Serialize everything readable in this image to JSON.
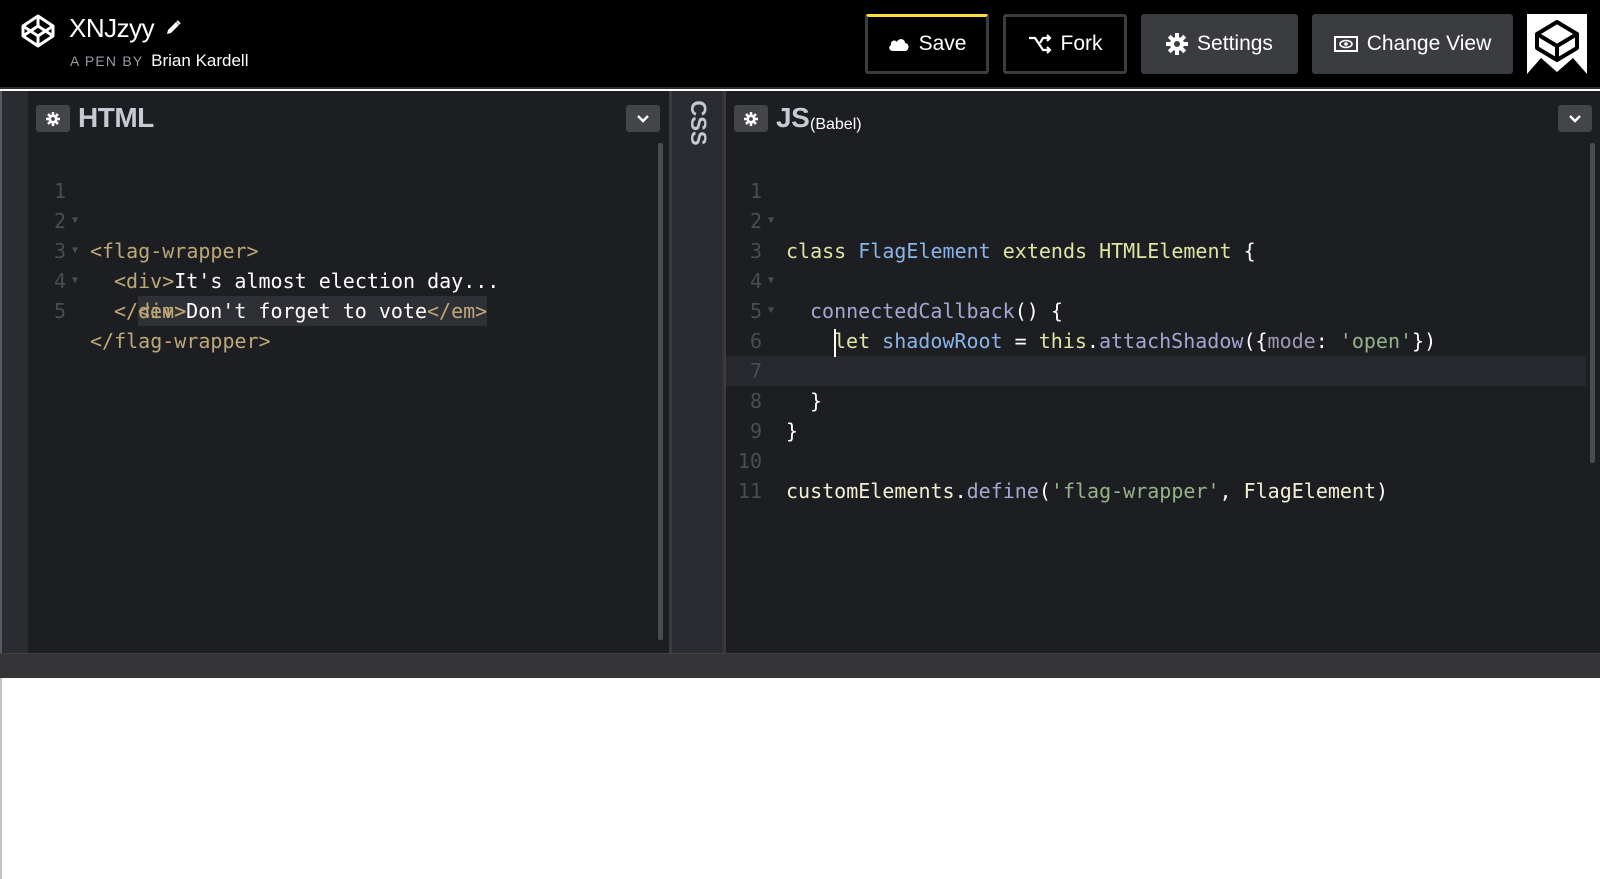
{
  "header": {
    "pen_title": "XNJzyy",
    "byline_prefix": "A PEN BY",
    "author": "Brian Kardell",
    "buttons": {
      "save": "Save",
      "fork": "Fork",
      "settings": "Settings",
      "change_view": "Change View"
    },
    "save_accent_color": "#ffdd40"
  },
  "html_editor": {
    "title": "HTML",
    "lines": [
      {
        "n": "1",
        "parts": [
          "<flag-wrapper>"
        ]
      },
      {
        "n": "2",
        "parts": [
          "<div>",
          "It's almost election day..."
        ]
      },
      {
        "n": "3",
        "parts": [
          "<em>",
          "Don't forget to vote",
          "</em>"
        ]
      },
      {
        "n": "4",
        "parts": [
          "</div>"
        ]
      },
      {
        "n": "5",
        "parts": [
          "</flag-wrapper>"
        ]
      }
    ]
  },
  "css_editor": {
    "title": "CSS"
  },
  "js_editor": {
    "title": "JS",
    "preprocessor": "(Babel)",
    "lines": [
      {
        "n": "1",
        "parts": [
          "class ",
          "FlagElement",
          " extends ",
          "HTMLElement",
          " {"
        ]
      },
      {
        "n": "2",
        "parts": []
      },
      {
        "n": "3",
        "parts": [
          "connectedCallback",
          "() {"
        ]
      },
      {
        "n": "4",
        "parts": [
          "let ",
          "shadowRoot",
          " = ",
          "this",
          ".",
          "attachShadow",
          "({",
          "mode",
          ": ",
          "'open'",
          "})"
        ]
      },
      {
        "n": "5",
        "parts": []
      },
      {
        "n": "6",
        "parts": []
      },
      {
        "n": "7",
        "parts": [
          "}"
        ]
      },
      {
        "n": "8",
        "parts": [
          "}"
        ]
      },
      {
        "n": "9",
        "parts": []
      },
      {
        "n": "10",
        "parts": [
          "customElements",
          ".",
          "define",
          "(",
          "'flag-wrapper'",
          ", ",
          "FlagElement",
          ")"
        ]
      },
      {
        "n": "11",
        "parts": []
      }
    ]
  },
  "icons": [
    "codepen-logo-icon",
    "pencil-icon",
    "cloud-icon",
    "fork-icon",
    "gear-icon",
    "eye-icon",
    "chevron-down-icon"
  ]
}
